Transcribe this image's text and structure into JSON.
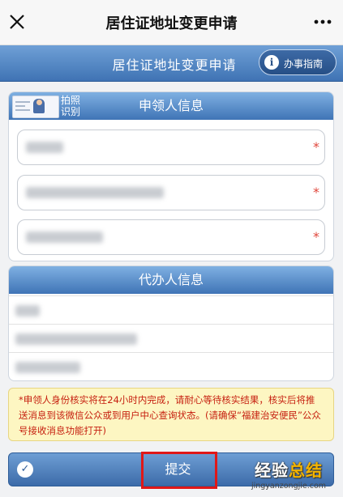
{
  "topbar": {
    "title": "居住证地址变更申请",
    "close_icon": "close-icon",
    "more_icon": "more-icon"
  },
  "header": {
    "title": "居住证地址变更申请",
    "guide_button": {
      "icon": "info-icon",
      "label": "办事指南"
    }
  },
  "applicant": {
    "title": "申领人信息",
    "scan_label": "拍照识别",
    "fields": [
      {
        "required_mark": "*"
      },
      {
        "required_mark": "*"
      },
      {
        "required_mark": "*"
      }
    ]
  },
  "agent": {
    "title": "代办人信息"
  },
  "notice": {
    "text": "*申领人身份核实将在24小时内完成，请耐心等待核实结果，核实后将推送消息到该微信公众或到用户中心查询状态。(请确保“福建治安便民”公众号接收消息功能打开)"
  },
  "footer": {
    "submit_label": "提交",
    "check_icon": "checkmark-icon"
  },
  "watermark": {
    "big_prefix": "经验",
    "big_suffix": "总结",
    "small": "jingyanzongjie.com"
  },
  "colors": {
    "header_blue": "#3f73b4",
    "required_red": "#e0473c",
    "notice_bg": "#fdf6c2",
    "notice_text": "#c62010",
    "highlight_red": "#e01818"
  }
}
